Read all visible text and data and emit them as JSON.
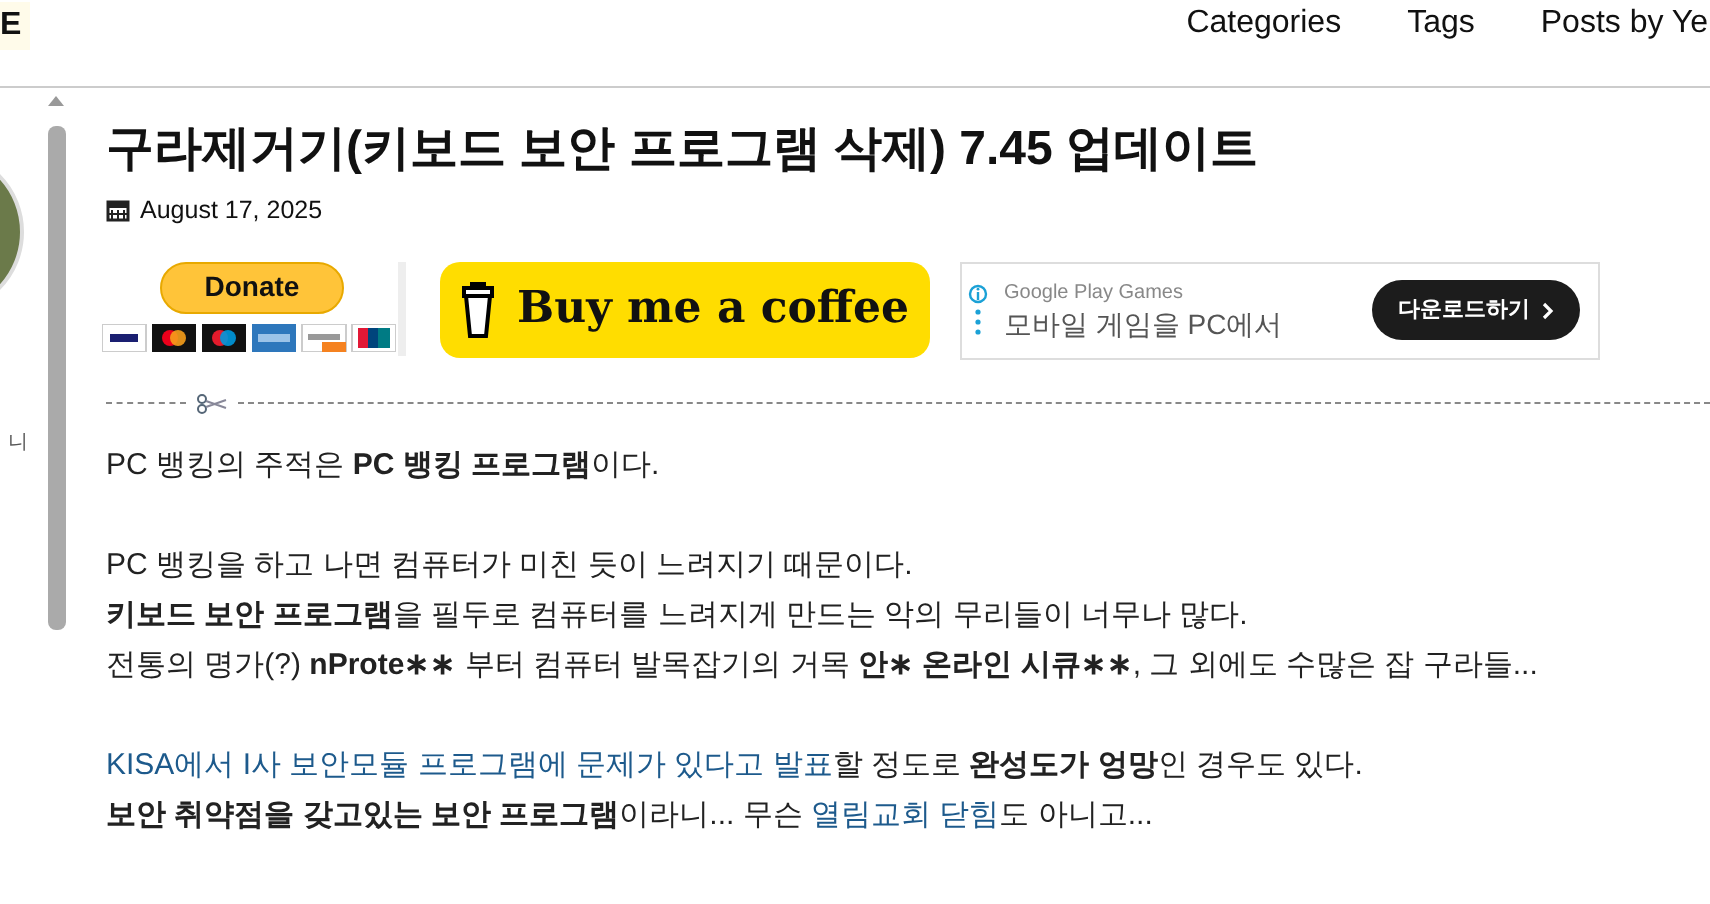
{
  "header": {
    "logo_fragment": "E",
    "nav": [
      {
        "label": "Categories"
      },
      {
        "label": "Tags"
      },
      {
        "label": "Posts by Ye"
      }
    ]
  },
  "sidebar": {
    "text_fragment": "니"
  },
  "post": {
    "title": "구라제거기(키보드 보안 프로그램 삭제) 7.45 업데이트",
    "date": "August 17, 2025",
    "donate": {
      "label": "Donate"
    },
    "coffee": {
      "label": "Buy me a coffee"
    },
    "ad": {
      "brand": "Google Play Games",
      "headline": "모바일 게임을 PC에서",
      "button": "다운로드하기"
    },
    "paragraphs": [
      [
        [
          {
            "kind": "text",
            "text": "PC 뱅킹의 주적은 "
          },
          {
            "kind": "bold",
            "text": "PC 뱅킹 프로그램"
          },
          {
            "kind": "text",
            "text": "이다."
          }
        ]
      ],
      [
        [
          {
            "kind": "text",
            "text": "PC 뱅킹을 하고 나면 컴퓨터가 미친 듯이 느려지기 때문이다."
          }
        ],
        [
          {
            "kind": "bold",
            "text": "키보드 보안 프로그램"
          },
          {
            "kind": "text",
            "text": "을 필두로 컴퓨터를 느려지게 만드는 악의 무리들이 너무나 많다."
          }
        ],
        [
          {
            "kind": "text",
            "text": "전통의 명가(?) "
          },
          {
            "kind": "bold",
            "text": "nProte∗∗"
          },
          {
            "kind": "text",
            "text": " 부터 컴퓨터 발목잡기의 거목 "
          },
          {
            "kind": "bold",
            "text": "안∗ 온라인 시큐∗∗"
          },
          {
            "kind": "text",
            "text": ", 그 외에도 수많은 잡 구라들..."
          }
        ]
      ],
      [
        [
          {
            "kind": "link",
            "text": "KISA에서 I사 보안모듈 프로그램에 문제가 있다고 발표"
          },
          {
            "kind": "text",
            "text": "할 정도로 "
          },
          {
            "kind": "bold",
            "text": "완성도가 엉망"
          },
          {
            "kind": "text",
            "text": "인 경우도 있다."
          }
        ],
        [
          {
            "kind": "bold",
            "text": "보안 취약점을 갖고있는 보안 프로그램"
          },
          {
            "kind": "text",
            "text": "이라니... 무슨 "
          },
          {
            "kind": "link",
            "text": "열림교회 닫힘"
          },
          {
            "kind": "text",
            "text": "도 아니고..."
          }
        ]
      ]
    ]
  }
}
